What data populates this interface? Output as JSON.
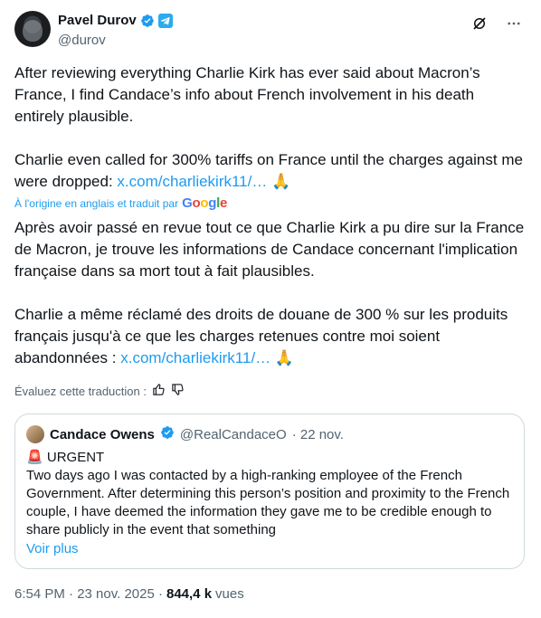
{
  "author": {
    "name": "Pavel Durov",
    "handle": "@durov"
  },
  "tweet": {
    "para1": "After reviewing everything Charlie Kirk has ever said about Macron’s France, I find Candace’s info about French involvement in his death entirely plausible.",
    "para2_prefix": "Charlie even called for 300% tariffs on France until the charges against me were dropped: ",
    "link": "x.com/charliekirk11/…",
    "emoji": "🙏"
  },
  "translation": {
    "label": "À l'origine en anglais et traduit par",
    "provider_letters": [
      "G",
      "o",
      "o",
      "g",
      "l",
      "e"
    ],
    "para1": "Après avoir passé en revue tout ce que Charlie Kirk a pu dire sur la France de Macron, je trouve les informations de Candace concernant l'implication française dans sa mort tout à fait plausibles.",
    "para2_prefix": "Charlie a même réclamé des droits de douane de 300 % sur les produits français jusqu'à ce que les charges retenues contre moi soient abandonnées : ",
    "link": "x.com/charliekirk11/…",
    "emoji": "🙏",
    "rate_label": "Évaluez cette traduction :"
  },
  "quote": {
    "name": "Candace Owens",
    "handle": "@RealCandaceO",
    "date": "· 22 nov.",
    "siren": "🚨",
    "headline": "URGENT",
    "body": "Two days ago I was contacted by a high-ranking employee of the French Government. After determining this person’s position and proximity to the French couple, I have deemed the information they gave me to be credible enough to share publicly in the event that something",
    "more": "Voir plus"
  },
  "footer": {
    "time": "6:54 PM · 23 nov. 2025 ·",
    "views": "844,4 k",
    "views_label": "vues"
  },
  "colors": {
    "accent": "#1d9bf0",
    "muted": "#536471",
    "text": "#0f1419",
    "border": "#cfd9de"
  }
}
